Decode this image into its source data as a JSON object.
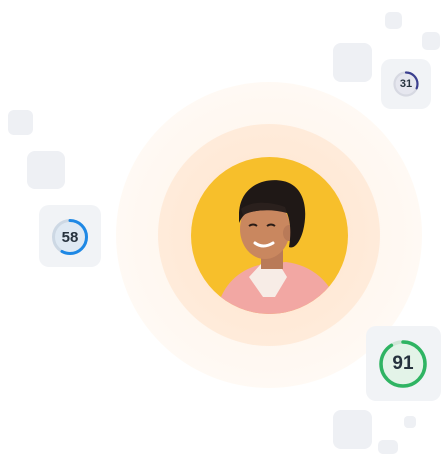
{
  "scores": [
    {
      "value": 31,
      "label": "31",
      "color": "#3b3f8f",
      "fill": "#e6e7ef"
    },
    {
      "value": 58,
      "label": "58",
      "color": "#1e88e5",
      "fill": "#dfe9f3"
    },
    {
      "value": 91,
      "label": "91",
      "color": "#2fb463",
      "fill": "#e3f3e8"
    }
  ],
  "colors": {
    "avatar_background": "#f7bf2b",
    "card_background": "#f1f3f6",
    "square_background": "#eef0f4"
  },
  "icons": {
    "avatar": "person-portrait"
  }
}
